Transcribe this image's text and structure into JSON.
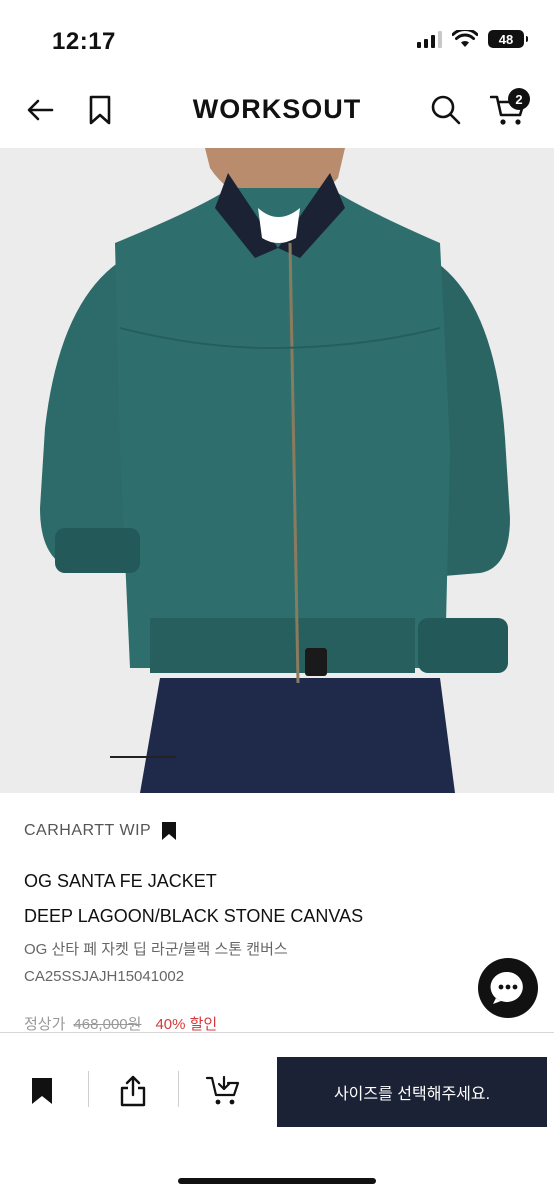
{
  "status_bar": {
    "time": "12:17",
    "battery": "48"
  },
  "header": {
    "logo": "WORKSOUT",
    "cart_count": "2"
  },
  "product": {
    "brand": "CARHARTT WIP",
    "name": "OG SANTA FE JACKET",
    "color": "DEEP LAGOON/BLACK STONE CANVAS",
    "korean_name": "OG 산타 페 자켓 딥 라군/블랙 스톤 캔버스",
    "sku": "CA25SSJAJH15041002",
    "price_label": "정상가",
    "original_price": "468,000원",
    "discount": "40% 할인"
  },
  "bottom_bar": {
    "cta_label": "사이즈를 선택해주세요."
  },
  "colors": {
    "accent": "#1c2235",
    "discount": "#d23b3b",
    "jacket": "#2c6b6a"
  },
  "icons": [
    "back-arrow-icon",
    "bookmark-icon",
    "search-icon",
    "cart-icon",
    "chat-icon",
    "share-icon",
    "add-to-cart-icon"
  ]
}
